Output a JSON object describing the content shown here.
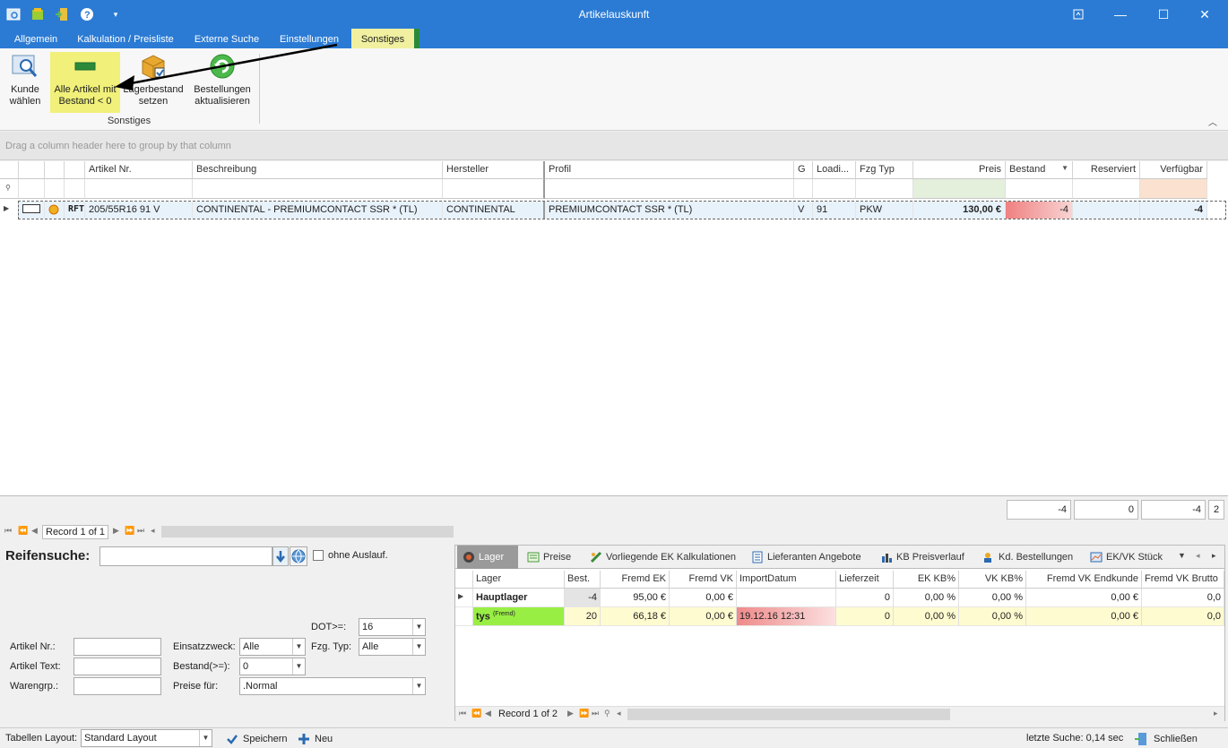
{
  "window": {
    "title": "Artikelauskunft"
  },
  "ribbon": {
    "tabs": [
      "Allgemein",
      "Kalkulation / Preisliste",
      "Externe Suche",
      "Einstellungen",
      "Sonstiges"
    ],
    "buttons": {
      "kunde_line1": "Kunde",
      "kunde_line2": "wählen",
      "alle_line1": "Alle Artikel mit",
      "alle_line2": "Bestand <  0",
      "lager_line1": "Lagerbestand",
      "lager_line2": "setzen",
      "best_line1": "Bestellungen",
      "best_line2": "aktualisieren"
    },
    "group_label": "Sonstiges"
  },
  "groupby_hint": "Drag a column header here to group by that column",
  "grid": {
    "columns": [
      "Artikel Nr.",
      "Beschreibung",
      "Hersteller",
      "Profil",
      "G",
      "Loadi...",
      "Fzg Typ",
      "Preis",
      "Bestand",
      "Reserviert",
      "Verfügbar"
    ],
    "row": {
      "logo": "RFT",
      "artikel_nr": "205/55R16 91 V",
      "beschreibung": "CONTINENTAL - PREMIUMCONTACT SSR * (TL)",
      "hersteller": "CONTINENTAL",
      "profil": "PREMIUMCONTACT SSR * (TL)",
      "g": "V",
      "load": "91",
      "fzg_typ": "PKW",
      "preis": "130,00 €",
      "bestand": "-4",
      "reserviert": "",
      "verfuegbar": "-4"
    },
    "totals": [
      "-4",
      "0",
      "-4",
      "2"
    ],
    "record": "Record 1 of 1"
  },
  "search": {
    "title": "Reifensuche:",
    "ohne_auslauf": "ohne Auslauf.",
    "dot_label": "DOT>=:",
    "dot_value": "16",
    "artikel_nr_label": "Artikel Nr.:",
    "artikel_text_label": "Artikel Text:",
    "warengrp_label": "Warengrp.:",
    "einsatz_label": "Einsatzzweck:",
    "einsatz_value": "Alle",
    "fzg_label": "Fzg. Typ:",
    "fzg_value": "Alle",
    "bestand_label": "Bestand(>=):",
    "bestand_value": "0",
    "preise_label": "Preise für:",
    "preise_value": ".Normal"
  },
  "detail": {
    "tabs": [
      "Lager",
      "Preise",
      "Vorliegende EK Kalkulationen",
      "Lieferanten Angebote",
      "KB Preisverlauf",
      "Kd. Bestellungen",
      "EK/VK Stück"
    ],
    "columns": [
      "Lager",
      "Best.",
      "Fremd EK",
      "Fremd VK",
      "ImportDatum",
      "Lieferzeit",
      "EK KB%",
      "VK KB%",
      "Fremd VK Endkunde",
      "Fremd VK Brutto"
    ],
    "rows": [
      {
        "lager": "Hauptlager",
        "fremd_tag": "",
        "best": "-4",
        "fremd_ek": "95,00 €",
        "fremd_vk": "0,00 €",
        "import": "",
        "lieferzeit": "0",
        "ek_kb": "0,00 %",
        "vk_kb": "0,00 %",
        "vk_end": "0,00 €",
        "vk_brutto": "0,0"
      },
      {
        "lager": "tys",
        "fremd_tag": "(Fremd)",
        "best": "20",
        "fremd_ek": "66,18 €",
        "fremd_vk": "0,00 €",
        "import": "19.12.16 12:31",
        "lieferzeit": "0",
        "ek_kb": "0,00 %",
        "vk_kb": "0,00 %",
        "vk_end": "0,00 €",
        "vk_brutto": "0,0"
      }
    ],
    "record": "Record 1 of 2"
  },
  "status": {
    "layout_label": "Tabellen Layout:",
    "layout_value": "Standard Layout",
    "save": "Speichern",
    "new": "Neu",
    "last_search": "letzte Suche: 0,14 sec",
    "close": "Schließen"
  },
  "colors": {
    "titlebar": "#2b7bd4",
    "highlight": "#f0f07a",
    "negative": "#f08080",
    "fremd": "#99ee44"
  }
}
